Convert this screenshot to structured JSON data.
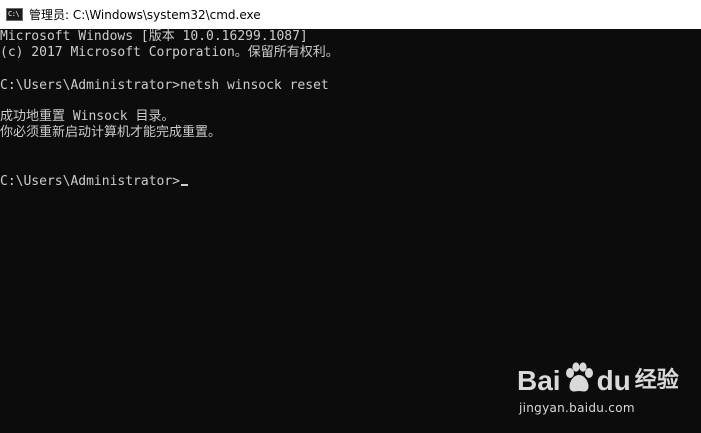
{
  "window": {
    "title": "管理员: C:\\Windows\\system32\\cmd.exe",
    "icon_name": "console-app-icon",
    "icon_glyph": "C:\\"
  },
  "console": {
    "lines": [
      "Microsoft Windows [版本 10.0.16299.1087]",
      "(c) 2017 Microsoft Corporation。保留所有权利。",
      "",
      "C:\\Users\\Administrator>netsh winsock reset",
      "",
      "成功地重置 Winsock 目录。",
      "你必须重新启动计算机才能完成重置。",
      "",
      "",
      "C:\\Users\\Administrator>"
    ],
    "background_color": "#0c0c0c",
    "text_color": "#cccccc"
  },
  "watermark": {
    "brand_left": "Bai",
    "brand_right": "du",
    "brand_cn": "经验",
    "url": "jingyan.baidu.com",
    "icon_name": "baidu-paw-icon"
  }
}
